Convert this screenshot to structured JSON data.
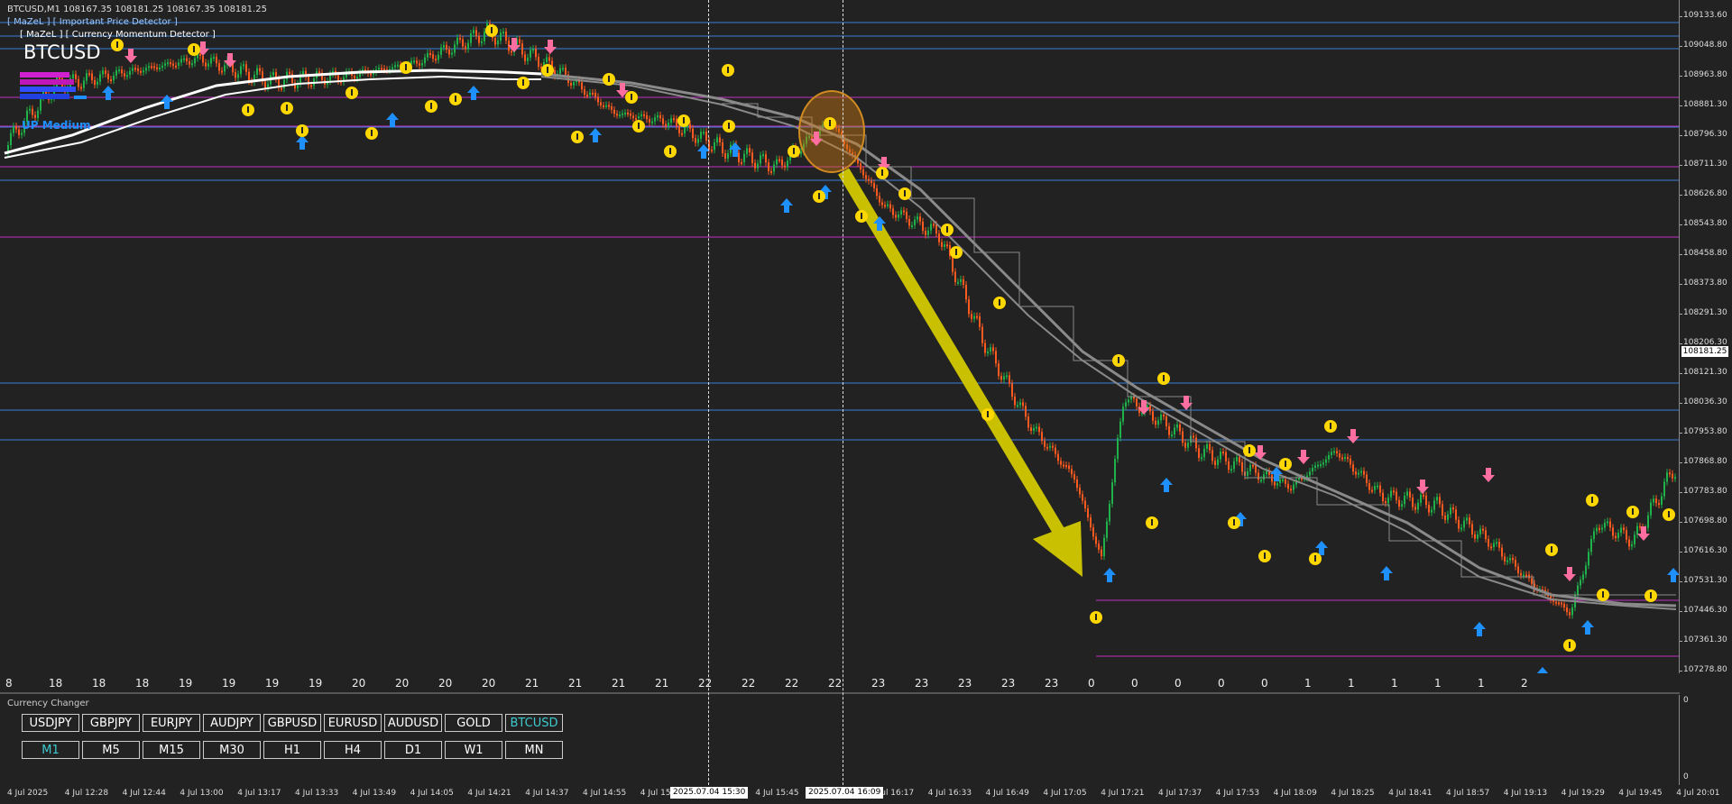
{
  "header": {
    "symbol_info": "BTCUSD,M1  108167.35 108181.25 108167.35 108181.25",
    "indicator1": "[ MaZeL ] [ Important Price Detector ]",
    "indicator2": "[ MaZeL ] [ Currency Momentum Detector ]",
    "symbol_big": "BTCUSD",
    "trend_badge": "UP Medium"
  },
  "price_axis": {
    "ticks": [
      "109133.60",
      "109048.80",
      "108963.80",
      "108881.30",
      "108796.30",
      "108711.30",
      "108626.80",
      "108543.80",
      "108458.80",
      "108373.80",
      "108291.30",
      "108206.30",
      "108121.30",
      "108036.30",
      "107953.80",
      "107868.80",
      "107783.80",
      "107698.80",
      "107616.30",
      "107531.30",
      "107446.30",
      "107361.30",
      "107278.80"
    ],
    "current": "108181.25"
  },
  "mini_dates": [
    "8",
    "18",
    "18",
    "18",
    "19",
    "19",
    "19",
    "19",
    "20",
    "20",
    "20",
    "20",
    "21",
    "21",
    "21",
    "21",
    "22",
    "22",
    "22",
    "22",
    "23",
    "23",
    "23",
    "23",
    "23",
    "0",
    "0",
    "0",
    "0",
    "0",
    "1",
    "1",
    "1",
    "1",
    "1",
    "2"
  ],
  "sub_panel": {
    "label": "Currency Changer",
    "symbols": [
      "USDJPY",
      "GBPJPY",
      "EURJPY",
      "AUDJPY",
      "GBPUSD",
      "EURUSD",
      "AUDUSD",
      "GOLD",
      "BTCUSD"
    ],
    "active_symbol": "BTCUSD",
    "timeframes": [
      "M1",
      "M5",
      "M15",
      "M30",
      "H1",
      "H4",
      "D1",
      "W1",
      "MN"
    ],
    "active_timeframe": "M1",
    "axis_top": "0",
    "axis_bottom": "0"
  },
  "time_axis": {
    "ticks": [
      "4 Jul 2025",
      "4 Jul 12:28",
      "4 Jul 12:44",
      "4 Jul 13:00",
      "4 Jul 13:17",
      "4 Jul 13:33",
      "4 Jul 13:49",
      "4 Jul 14:05",
      "4 Jul 14:21",
      "4 Jul 14:37",
      "4 Jul 14:55",
      "4 Jul 15:",
      "",
      "4 Jul 15:45",
      "",
      "4 Jul 16:17",
      "4 Jul 16:33",
      "4 Jul 16:49",
      "4 Jul 17:05",
      "4 Jul 17:21",
      "4 Jul 17:37",
      "4 Jul 17:53",
      "4 Jul 18:09",
      "4 Jul 18:25",
      "4 Jul 18:41",
      "4 Jul 18:57",
      "4 Jul 19:13",
      "4 Jul 19:29",
      "4 Jul 19:45",
      "4 Jul 20:01"
    ],
    "cursor1": "2025.07.04 15:30",
    "cursor2": "2025.07.04 16:09"
  },
  "colors": {
    "background": "#222222",
    "bull": "#1fb24a",
    "bear": "#ff5a1f",
    "level_blue": "#3a7fd5",
    "level_magenta": "#c030c0",
    "ma": "#8a8a8a",
    "arrow": "#c8c000",
    "buy_arrow": "#1e90ff",
    "sell_arrow": "#ff6ea0",
    "coin": "#ffd700",
    "accent_text": "#3ecbd0"
  }
}
